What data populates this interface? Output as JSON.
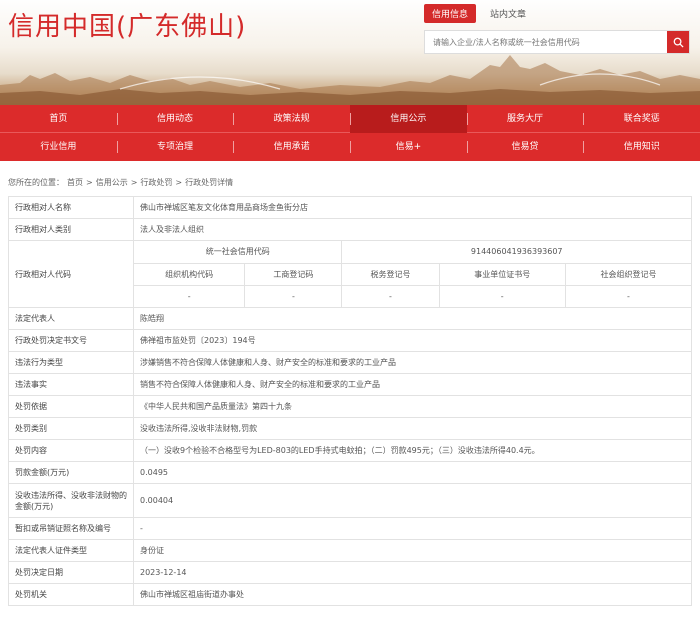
{
  "header": {
    "logo": "信用中国(广东佛山)",
    "tabs": [
      {
        "label": "信用信息",
        "active": true
      },
      {
        "label": "站内文章",
        "active": false
      }
    ],
    "search_placeholder": "请输入企业/法人名称或统一社会信用代码"
  },
  "nav": {
    "row1": [
      {
        "label": "首页",
        "active": false
      },
      {
        "label": "信用动态",
        "active": false
      },
      {
        "label": "政策法规",
        "active": false
      },
      {
        "label": "信用公示",
        "active": true
      },
      {
        "label": "服务大厅",
        "active": false
      },
      {
        "label": "联合奖惩",
        "active": false
      }
    ],
    "row2": [
      {
        "label": "行业信用",
        "active": false
      },
      {
        "label": "专项治理",
        "active": false
      },
      {
        "label": "信用承诺",
        "active": false
      },
      {
        "label": "信易+",
        "active": false
      },
      {
        "label": "信易贷",
        "active": false
      },
      {
        "label": "信用知识",
        "active": false
      }
    ]
  },
  "breadcrumb": {
    "prefix": "您所在的位置：",
    "items": [
      "首页",
      "信用公示",
      "行政处罚",
      "行政处罚详情"
    ],
    "separator": ">"
  },
  "detail": {
    "name_label": "行政相对人名称",
    "name": "佛山市禅城区笔友文化体育用品商场金鱼街分店",
    "type_label": "行政相对人类别",
    "type": "法人及非法人组织",
    "code_label": "行政相对人代码",
    "uscc_label": "统一社会信用代码",
    "uscc": "914406041936393607",
    "code_headers": [
      "组织机构代码",
      "工商登记码",
      "税务登记号",
      "事业单位证书号",
      "社会组织登记号"
    ],
    "code_values": [
      "-",
      "-",
      "-",
      "-",
      "-"
    ],
    "rows": [
      {
        "label": "法定代表人",
        "value": "陈皓翔"
      },
      {
        "label": "行政处罚决定书文号",
        "value": "佛禅祖市监处罚〔2023〕194号"
      },
      {
        "label": "违法行为类型",
        "value": "涉嫌销售不符合保障人体健康和人身、财产安全的标准和要求的工业产品"
      },
      {
        "label": "违法事实",
        "value": "销售不符合保障人体健康和人身、财产安全的标准和要求的工业产品"
      },
      {
        "label": "处罚依据",
        "value": "《中华人民共和国产品质量法》第四十九条"
      },
      {
        "label": "处罚类别",
        "value": "没收违法所得,没收非法财物,罚款"
      },
      {
        "label": "处罚内容",
        "value": "（一）没收9个检验不合格型号为LED-803的LED手持式电蚊拍；（二）罚款495元；（三）没收违法所得40.4元。"
      },
      {
        "label": "罚款金额(万元)",
        "value": "0.0495"
      },
      {
        "label": "没收违法所得、没收非法财物的金额(万元)",
        "value": "0.00404"
      },
      {
        "label": "暂扣或吊销证照名称及编号",
        "value": "-"
      },
      {
        "label": "法定代表人证件类型",
        "value": "身份证"
      },
      {
        "label": "处罚决定日期",
        "value": "2023-12-14"
      },
      {
        "label": "处罚机关",
        "value": "佛山市禅城区祖庙街道办事处"
      }
    ]
  }
}
